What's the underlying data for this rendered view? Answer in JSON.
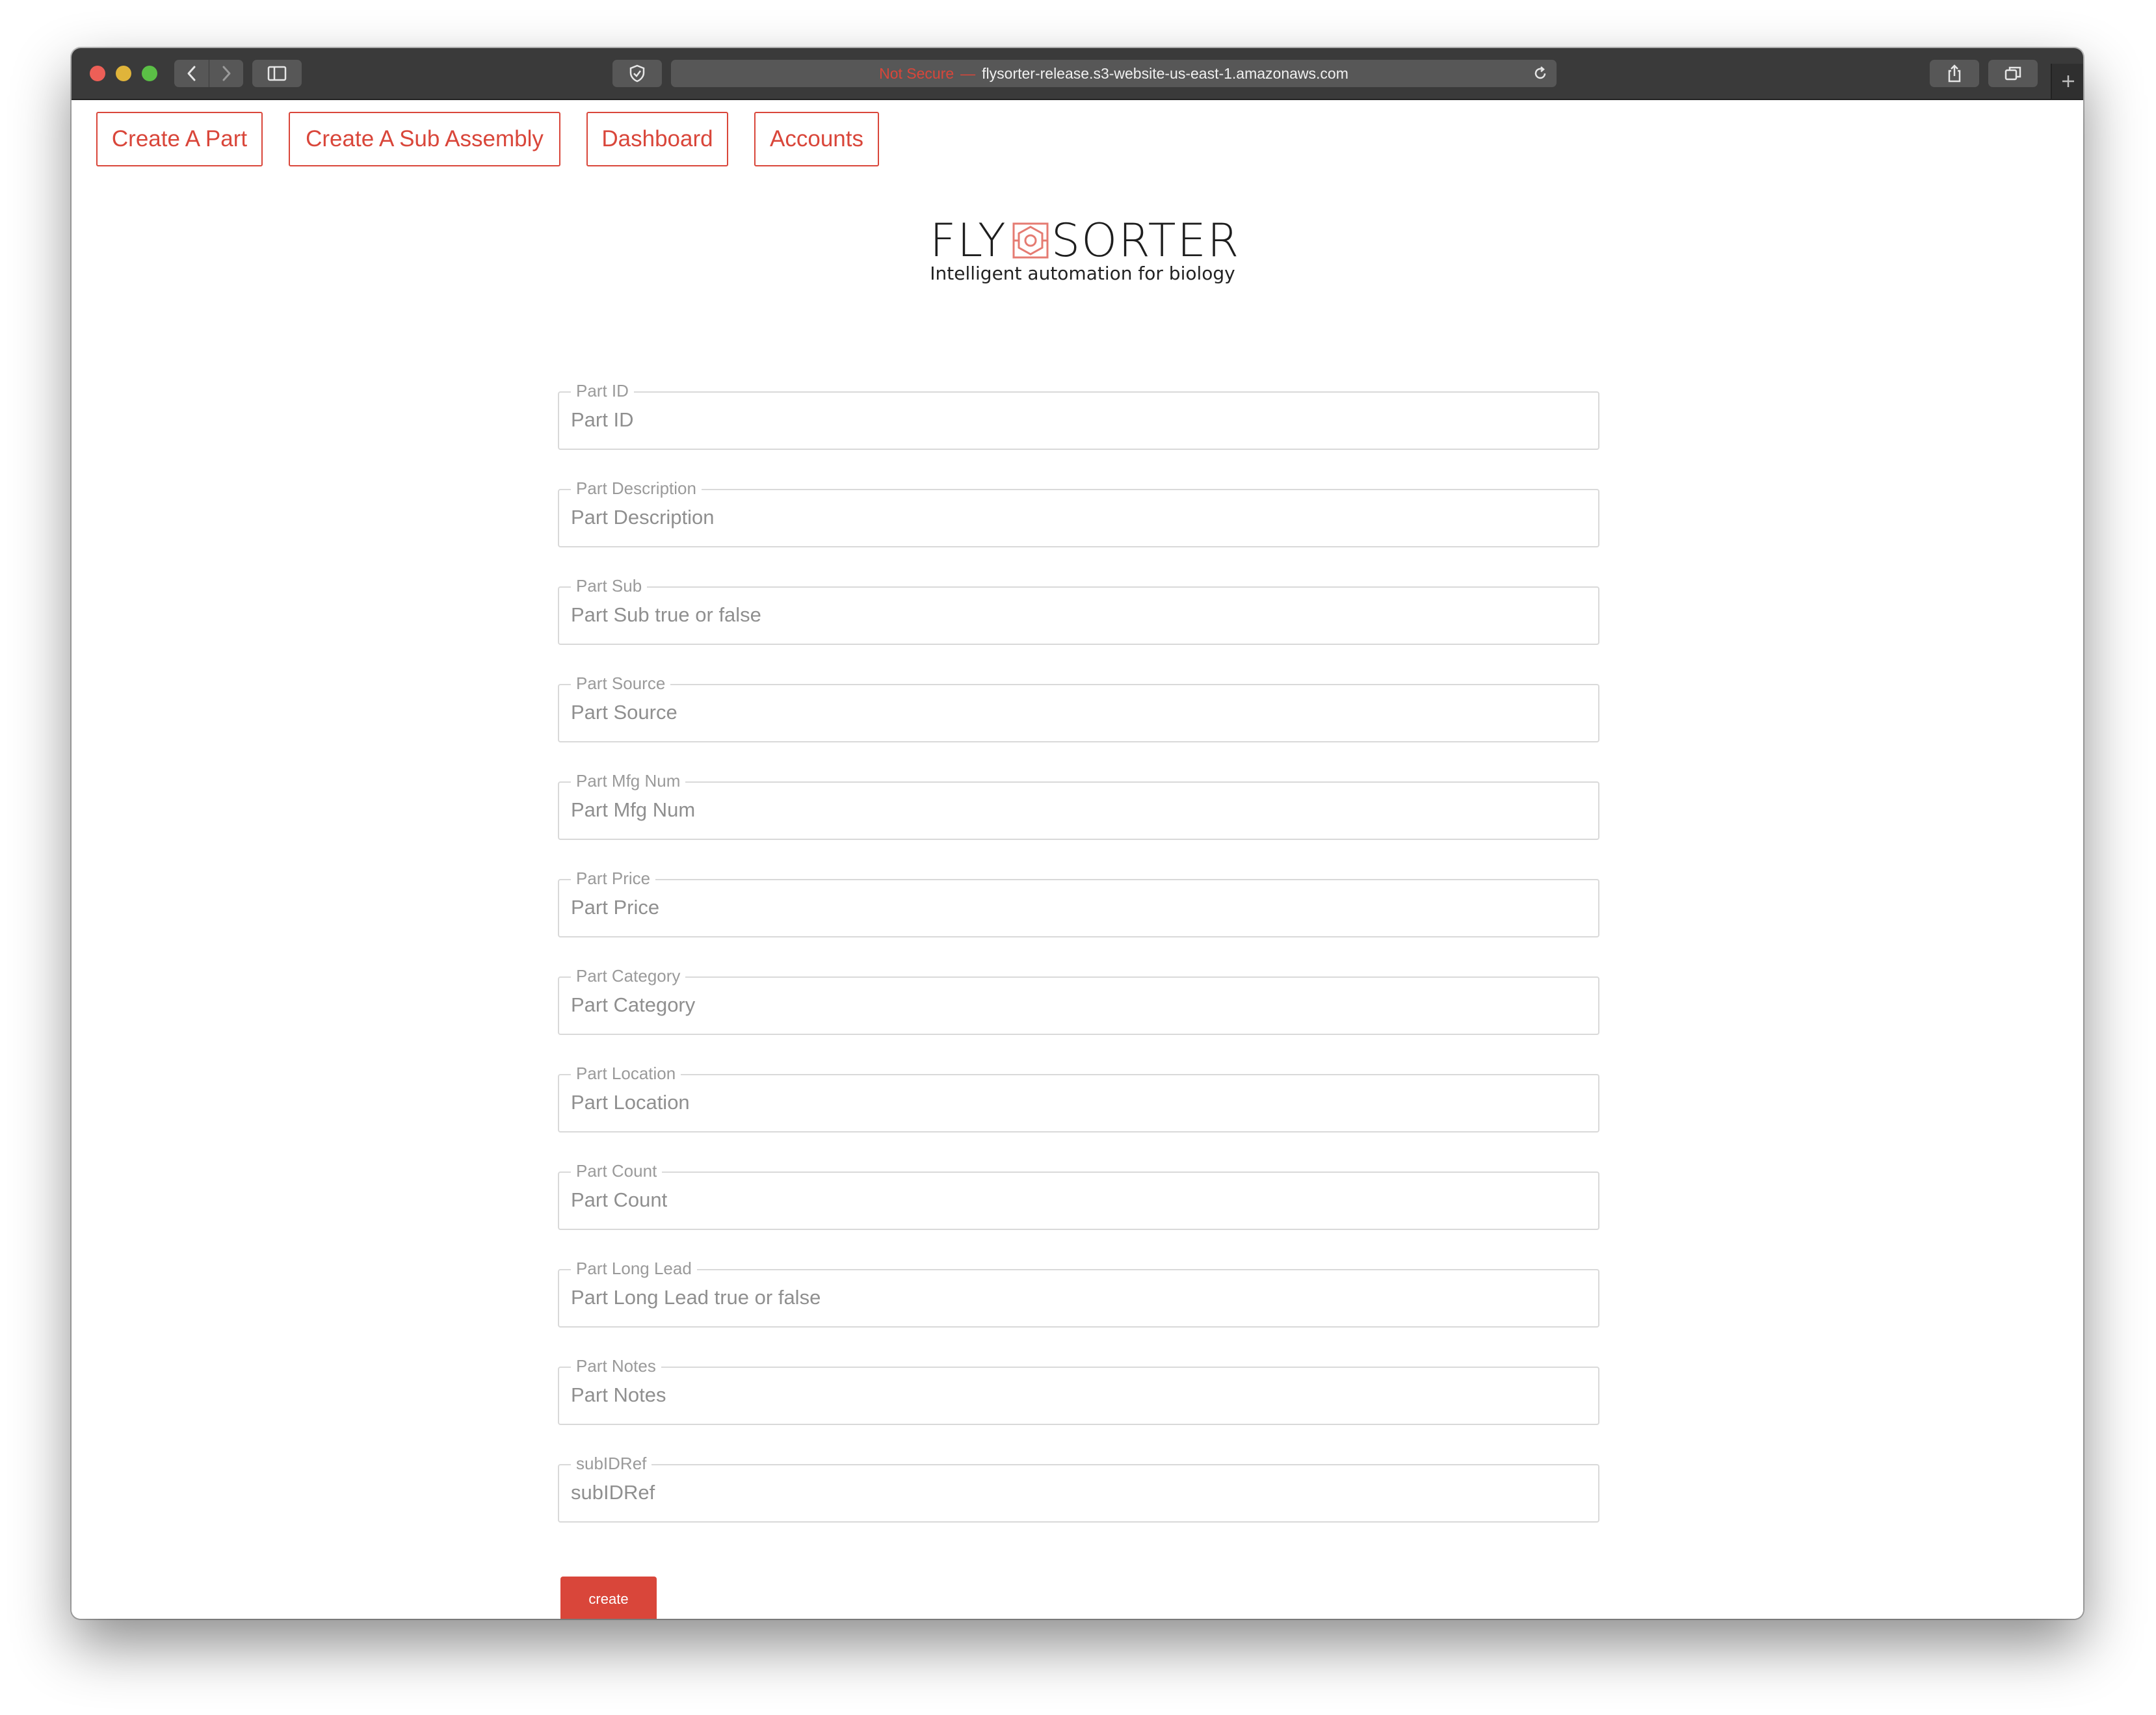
{
  "browser": {
    "security_label": "Not Secure",
    "security_separator": "—",
    "url": "flysorter-release.s3-website-us-east-1.amazonaws.com"
  },
  "nav": {
    "items": [
      {
        "label": "Create A Part"
      },
      {
        "label": "Create A Sub Assembly"
      },
      {
        "label": "Dashboard"
      },
      {
        "label": "Accounts"
      }
    ]
  },
  "logo": {
    "word_left": "FLY",
    "word_right": "SORTER",
    "tagline": "Intelligent automation for biology"
  },
  "form": {
    "fields": [
      {
        "label": "Part ID",
        "placeholder": "Part ID"
      },
      {
        "label": "Part Description",
        "placeholder": "Part Description"
      },
      {
        "label": "Part Sub",
        "placeholder": "Part Sub true or false"
      },
      {
        "label": "Part Source",
        "placeholder": "Part Source"
      },
      {
        "label": "Part Mfg Num",
        "placeholder": "Part Mfg Num"
      },
      {
        "label": "Part Price",
        "placeholder": "Part Price"
      },
      {
        "label": "Part Category",
        "placeholder": "Part Category"
      },
      {
        "label": "Part Location",
        "placeholder": "Part Location"
      },
      {
        "label": "Part Count",
        "placeholder": "Part Count"
      },
      {
        "label": "Part Long Lead",
        "placeholder": "Part Long Lead true or false"
      },
      {
        "label": "Part Notes",
        "placeholder": "Part Notes"
      },
      {
        "label": "subIDRef",
        "placeholder": "subIDRef"
      }
    ],
    "submit_label": "create"
  },
  "colors": {
    "accent": "#d9463a",
    "toolbar": "#3a3a3a",
    "field_border": "#d9d9d9"
  }
}
